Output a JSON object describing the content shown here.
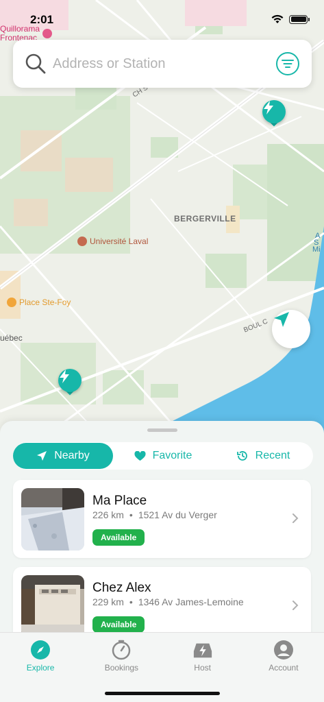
{
  "status_bar": {
    "time": "2:01"
  },
  "search": {
    "placeholder": "Address or Station"
  },
  "map": {
    "labels": {
      "district": "BERGERVILLE",
      "university": "Université Laval",
      "mall": "Place Ste-Foy",
      "top_poi_line1": "Quillorama",
      "top_poi_line2": "Frontenac",
      "road_ch": "CH S",
      "road_boul": "BOUL C",
      "edge_left": "uébec",
      "water_1": "A",
      "water_2": "S",
      "water_3": "Mi"
    }
  },
  "sheet": {
    "tabs": [
      {
        "label": "Nearby",
        "icon": "location-arrow-icon"
      },
      {
        "label": "Favorite",
        "icon": "heart-icon"
      },
      {
        "label": "Recent",
        "icon": "history-icon"
      }
    ],
    "stations": [
      {
        "name": "Ma Place",
        "distance": "226 km",
        "address": "1521 Av du Verger",
        "status": "Available"
      },
      {
        "name": "Chez Alex",
        "distance": "229 km",
        "address": "1346 Av James-Lemoine",
        "status": "Available"
      }
    ]
  },
  "tabbar": {
    "items": [
      {
        "label": "Explore",
        "icon": "compass-icon"
      },
      {
        "label": "Bookings",
        "icon": "timer-icon"
      },
      {
        "label": "Host",
        "icon": "host-car-icon"
      },
      {
        "label": "Account",
        "icon": "account-icon"
      }
    ]
  },
  "colors": {
    "accent": "#17b7a9",
    "available": "#22b14c",
    "water": "#5fbde8",
    "park": "#cfe3c8"
  }
}
